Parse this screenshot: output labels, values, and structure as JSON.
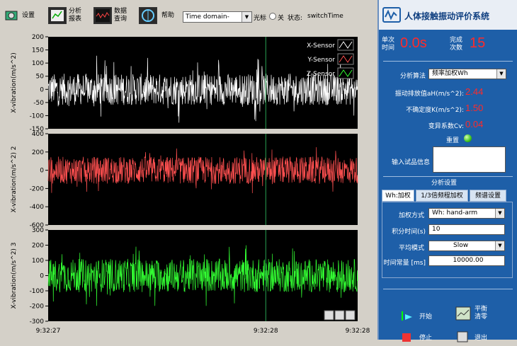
{
  "toolbar": {
    "settings_label": "设置",
    "analysis_label": "分析\n报表",
    "data_label": "数据\n查询",
    "help_label": "帮助",
    "domain_value": "Time domain-",
    "cursor_label": "光标",
    "off_label": "关",
    "status_label": "状态:",
    "status_value": "switchTime"
  },
  "app": {
    "title": "人体接触振动评价系统"
  },
  "panel": {
    "single_time_label": "单次\n时间",
    "single_time_value": "0.0s",
    "done_count_label": "完成\n次数",
    "done_count_value": "15",
    "algo_label": "分析算法",
    "algo_value": "频率加权Wh",
    "vib_label": "振动排放值aH(m/s^2):",
    "vib_value": "2.44",
    "uncert_label": "不确定度K(m/s^2):",
    "uncert_value": "1.50",
    "cv_label": "变异系数Cv:",
    "cv_value": "0.04",
    "reset_label": "重置",
    "sample_info_label": "输入试品信息",
    "sample_info_value": "",
    "settings_title": "分析设置",
    "tabs": [
      "Wh:加权",
      "1/3倍频程加权",
      "频谱设置"
    ],
    "weight_mode_label": "加权方式",
    "weight_mode_value": "Wh: hand-arm",
    "integ_time_label": "积分时间(s)",
    "integ_time_value": "10",
    "avg_mode_label": "平均模式",
    "avg_mode_value": "Slow",
    "time_const_label": "时间常量 [ms]",
    "time_const_value": "10000.00",
    "start_label": "开始",
    "balance_label": "平衡\n清零",
    "stop_label": "停止",
    "exit_label": "退出"
  },
  "colors": {
    "x": "#ffffff",
    "y": "#ff5050",
    "z": "#33ff33",
    "panel": "#1e5fa8",
    "value_red": "#ff2a2a"
  },
  "chart_data": [
    {
      "type": "line",
      "ylabel": "X-vibration(m/s^2)",
      "ylim": [
        -150,
        200
      ],
      "yticks": [
        200,
        150,
        100,
        50,
        0,
        -50,
        -100,
        -150
      ],
      "legend": [
        "X-Sensor",
        "Y-Sensor",
        "Z-Sensor"
      ],
      "series": [
        {
          "name": "X-Sensor",
          "color": "#ffffff",
          "mean": 0,
          "amplitude": 60,
          "peak": 130
        }
      ]
    },
    {
      "type": "line",
      "ylabel": "X-vibration(m/s^2) 2",
      "ylim": [
        -600,
        400
      ],
      "yticks": [
        400,
        200,
        0,
        -200,
        -400,
        -600
      ],
      "series": [
        {
          "color": "#ff5050",
          "mean": 0,
          "amplitude": 150,
          "peak": 260
        }
      ]
    },
    {
      "type": "line",
      "ylabel": "X-vibration(m/s^2) 3",
      "ylim": [
        -300,
        300
      ],
      "yticks": [
        300,
        200,
        100,
        0,
        -100,
        -200,
        -300
      ],
      "series": [
        {
          "color": "#33ff33",
          "mean": 0,
          "amplitude": 110,
          "peak": 200
        }
      ]
    }
  ],
  "x_ticks": [
    "9:32:27",
    "9:32:28",
    "9:32:28"
  ]
}
